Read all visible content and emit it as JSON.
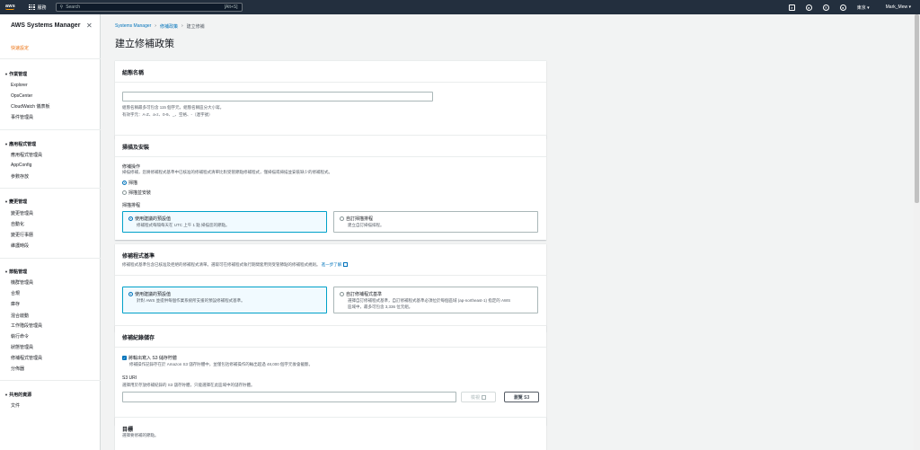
{
  "topbar": {
    "logo": "aws",
    "services": "服務",
    "search_placeholder": "Search",
    "search_shortcut": "[Alt+S]",
    "region": "東京 ▾",
    "user": "Mark_Mew ▾"
  },
  "sidebar": {
    "title": "AWS Systems Manager",
    "quick_setup": "快速設定",
    "sections": [
      {
        "title": "作業管理",
        "items": [
          "Explorer",
          "OpsCenter",
          "CloudWatch 儀表板",
          "事件管理員"
        ]
      },
      {
        "title": "應用程式管理",
        "items": [
          "應用程式管理員",
          "AppConfig",
          "參數存放"
        ]
      },
      {
        "title": "變更管理",
        "items": [
          "變更管理員",
          "自動化",
          "變更行事曆",
          "維護時段"
        ]
      },
      {
        "title": "節點管理",
        "items": [
          "機群管理員",
          "合規",
          "庫存",
          "混合啟動",
          "工作階段管理員",
          "執行命令",
          "狀態管理員",
          "修補程式管理員",
          "分佈器"
        ]
      },
      {
        "title": "共用的資源",
        "items": [
          "文件"
        ]
      }
    ]
  },
  "breadcrumb": [
    "Systems Manager",
    "修補政策",
    "建立修補"
  ],
  "page_title": "建立修補政策",
  "config_name": {
    "header": "組態名稱",
    "value": "",
    "help1": "組態名稱最多可包含 115 個字元，組態名稱區分大小寫。",
    "help2": "有效字元：A-Z、a-z、0-9、_、空格、-（連字號）"
  },
  "scan_install": {
    "header": "掃描及安裝",
    "op_label": "修補操作",
    "op_help": "掃描修補，您將修補程式基準中已核准的修補程式清單比對受管節點修補程式，僅掃描或掃描並安裝缺少的修補程式。",
    "radio_scan": "掃描",
    "radio_scan_install": "掃描並安裝",
    "schedule_label": "掃描排程",
    "tile1_title": "使用建議的預設值",
    "tile1_desc": "修補程式每隔每天在 UTC 上午 1 點 掃描您的節點。",
    "tile2_title": "自訂掃描排程",
    "tile2_desc": "建立自訂掃描排程。"
  },
  "baseline": {
    "header": "修補程式基準",
    "help": "修補程式基準包含已核准及拒絕的修補程式清單。選取可在修補程式執行期間套用到受管節點的修補程式規則。",
    "learn_more": "進一步了解",
    "tile1_title": "使用建議的預設值",
    "tile1_desc": "針對 AWS 並提供每個作業系統所支援的預設修補程式基準。",
    "tile2_title": "自訂修補程式基準",
    "tile2_desc1": "選擇自訂修補程式基準，自訂修補程式基準必須位於每個區域 (ap-northeast-1) 指定的 AWS",
    "tile2_desc2": "區域中，最多可包含 3,336 位元組。"
  },
  "log_storage": {
    "header": "修補紀錄儲存",
    "check_label": "將輸出寫入 S3 儲存貯體",
    "check_help": "修補操作記錄存在於 Amazon S3 儲存貯體中，並僅包括修補操作的輸出超過 48,000 個字元後會截斷。",
    "s3_label": "S3 URI",
    "s3_help": "選擇用於存放修補紀錄的 S3 儲存貯體，只能選擇在此區域中的儲存貯體。",
    "s3_value": "",
    "view_btn": "檢視",
    "browse_btn": "瀏覽 S3"
  },
  "targets": {
    "header": "目標",
    "help": "選擇要修補的節點。"
  }
}
